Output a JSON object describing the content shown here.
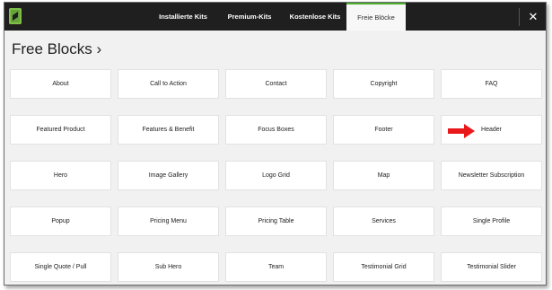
{
  "tabs": [
    {
      "label": "Installierte Kits"
    },
    {
      "label": "Premium-Kits"
    },
    {
      "label": "Kostenlose Kits"
    },
    {
      "label": "Freie Blöcke"
    }
  ],
  "close_label": "✕",
  "heading": "Free Blocks ›",
  "colors": {
    "accent": "#4caf2f",
    "arrow": "#e8181b",
    "topbar": "#1f1f1f"
  },
  "blocks": [
    "About",
    "Call to Action",
    "Contact",
    "Copyright",
    "FAQ",
    "Featured Product",
    "Features & Benefit",
    "Focus Boxes",
    "Footer",
    "Header",
    "Hero",
    "Image Gallery",
    "Logo Grid",
    "Map",
    "Newsletter Subscription",
    "Popup",
    "Pricing Menu",
    "Pricing Table",
    "Services",
    "Single Profile",
    "Single Quote / Pull",
    "Sub Hero",
    "Team",
    "Testimonial Grid",
    "Testimonial Slider"
  ]
}
